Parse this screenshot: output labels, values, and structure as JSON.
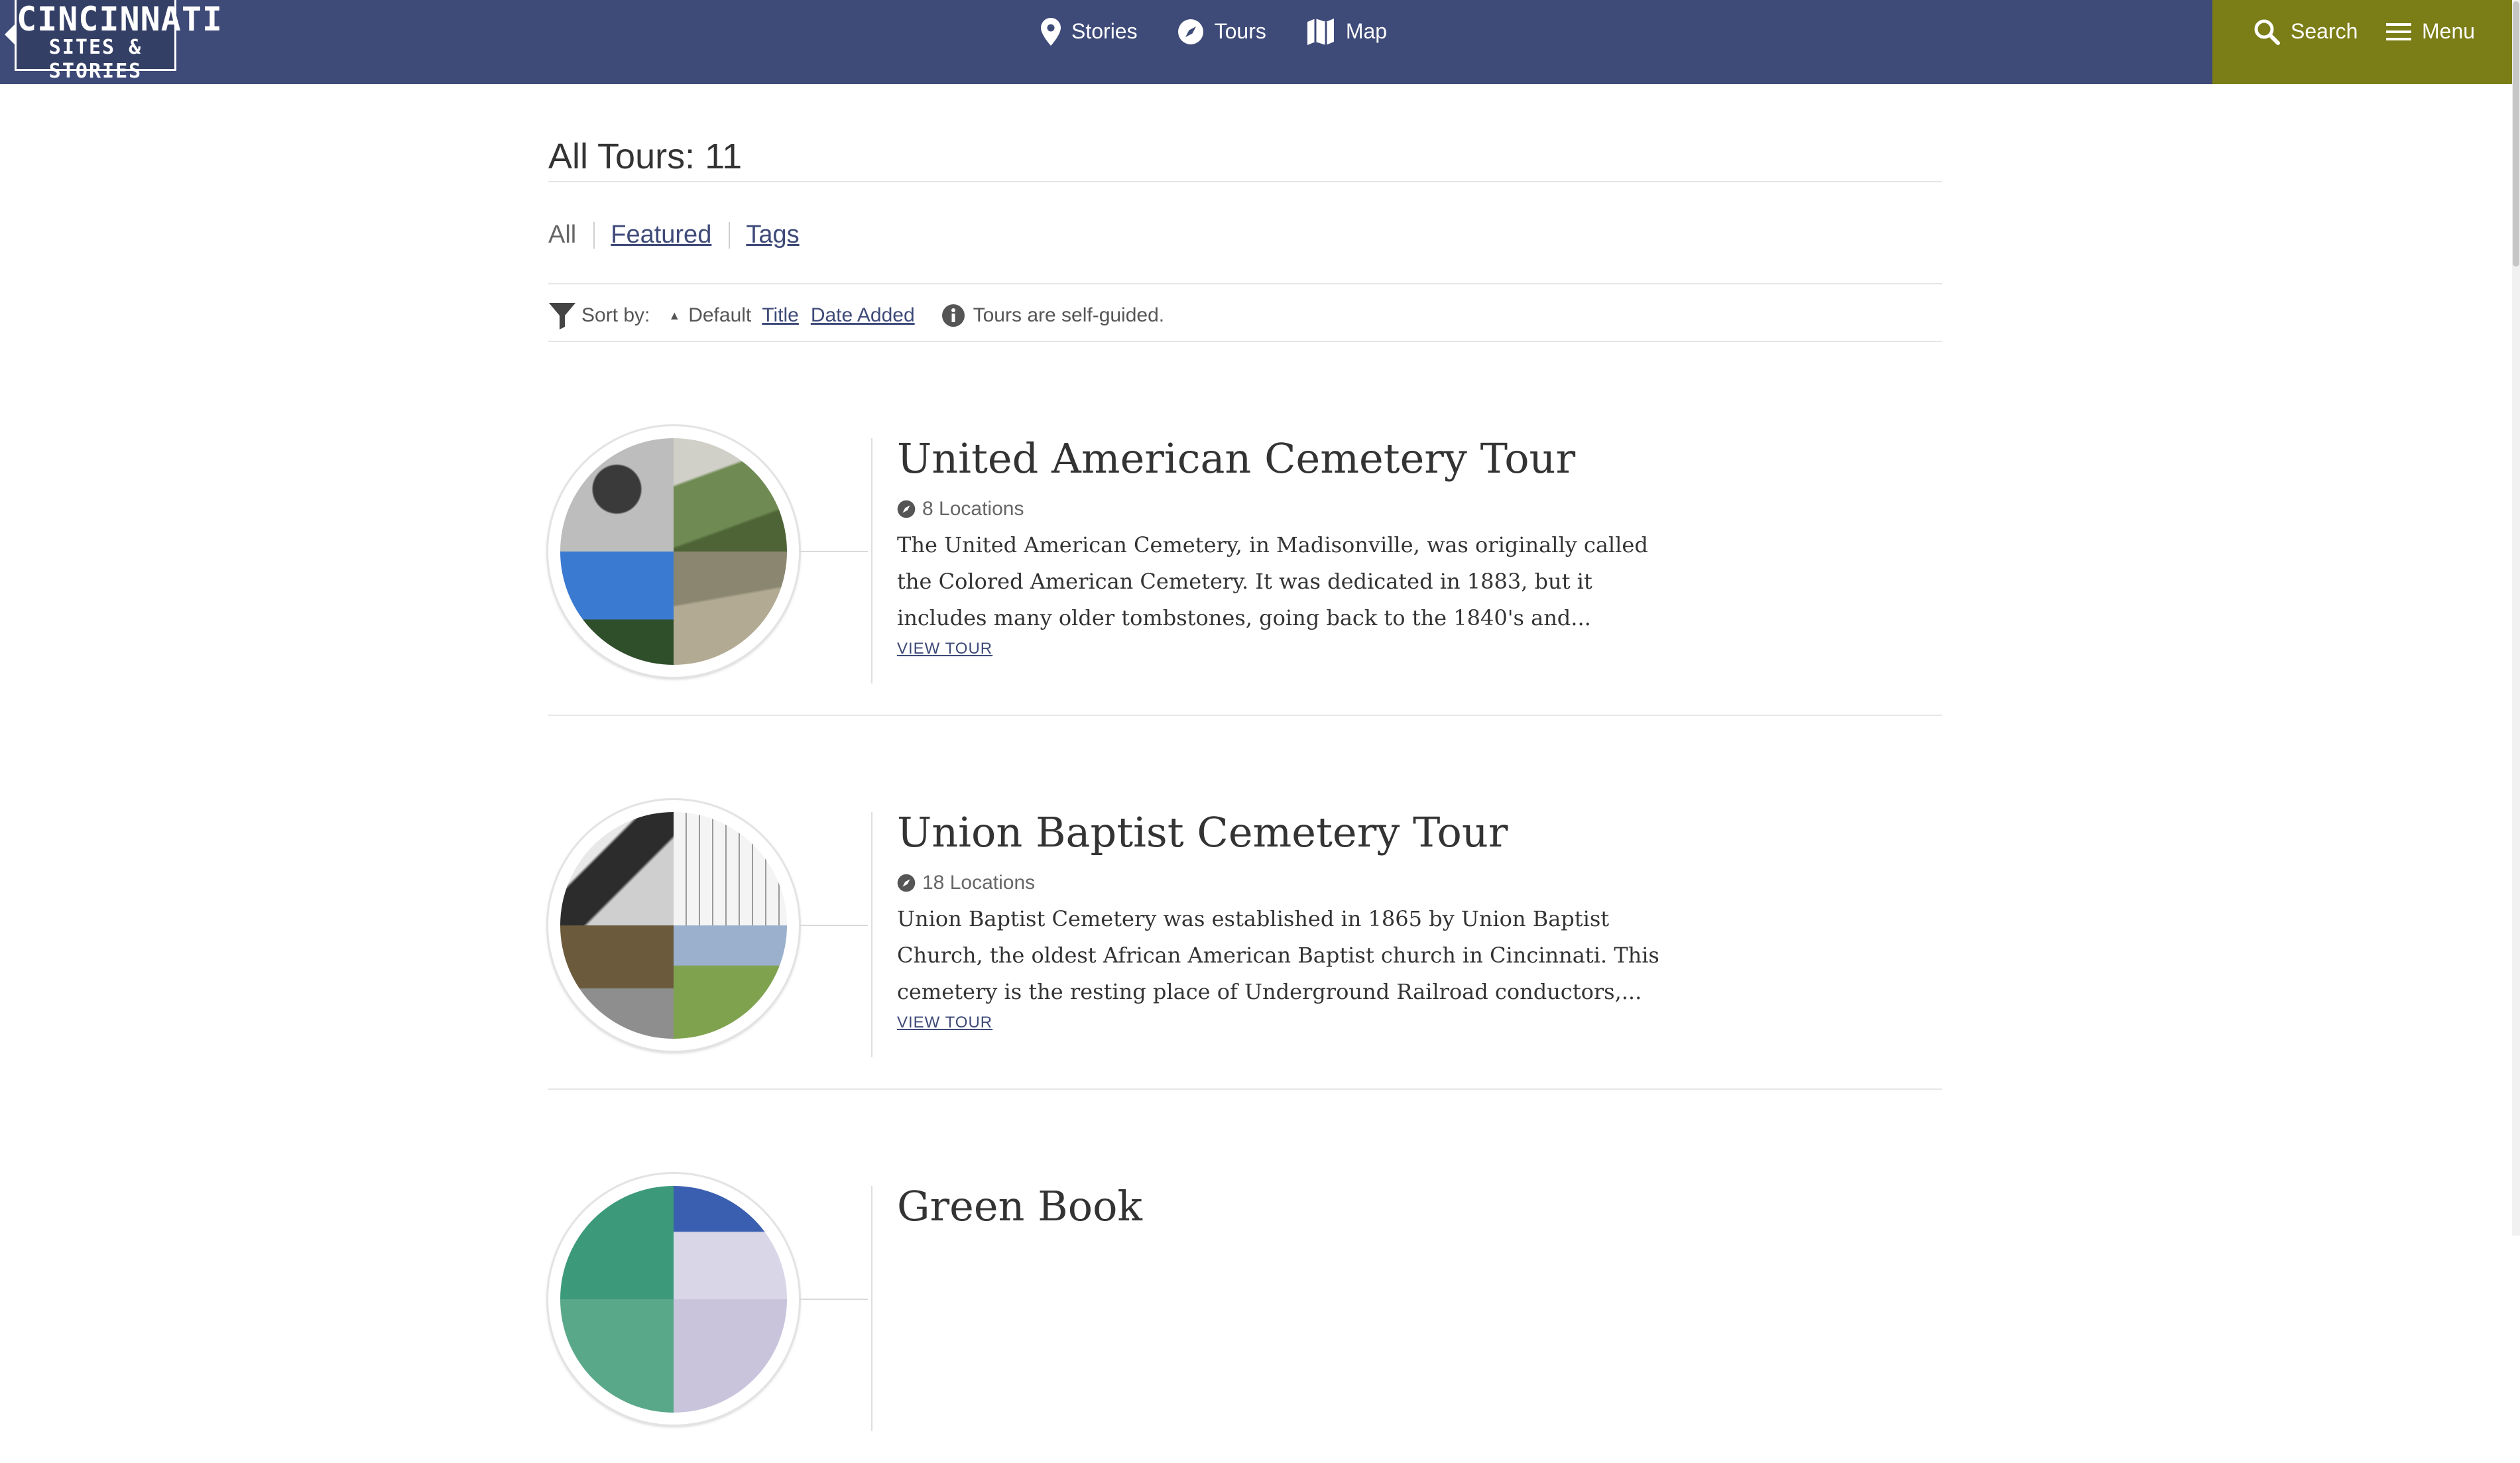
{
  "header": {
    "logo_line1": "CINCINNATI",
    "logo_line2": "SITES & STORIES",
    "nav": [
      {
        "label": "Stories",
        "icon": "map-pin-icon"
      },
      {
        "label": "Tours",
        "icon": "compass-icon"
      },
      {
        "label": "Map",
        "icon": "folded-map-icon"
      }
    ],
    "search_label": "Search",
    "menu_label": "Menu"
  },
  "main": {
    "title": "All Tours: 11",
    "filters": [
      {
        "label": "All",
        "current": true
      },
      {
        "label": "Featured",
        "current": false
      },
      {
        "label": "Tags",
        "current": false
      }
    ],
    "sort": {
      "label": "Sort by:",
      "default_label": "Default",
      "options": [
        "Title",
        "Date Added"
      ],
      "info": "Tours are self-guided."
    },
    "view_label": "VIEW TOUR",
    "tours": [
      {
        "title": "United American Cemetery Tour",
        "locations": "8 Locations",
        "description": "The United American Cemetery, in Madisonville, was originally called the Colored American Cemetery. It was dedicated in 1883, but it includes many older tombstones, going back to the 1840's and..."
      },
      {
        "title": "Union Baptist Cemetery Tour",
        "locations": "18 Locations",
        "description": "Union Baptist Cemetery was established in 1865 by Union Baptist Church, the oldest African American Baptist church in Cincinnati. This cemetery is the resting place of Underground Railroad conductors,..."
      },
      {
        "title": "Green Book",
        "locations": "",
        "description": ""
      }
    ]
  },
  "colors": {
    "header_bg": "#3e4a78",
    "action_bg": "#7b7d16",
    "link": "#3e4a78"
  }
}
